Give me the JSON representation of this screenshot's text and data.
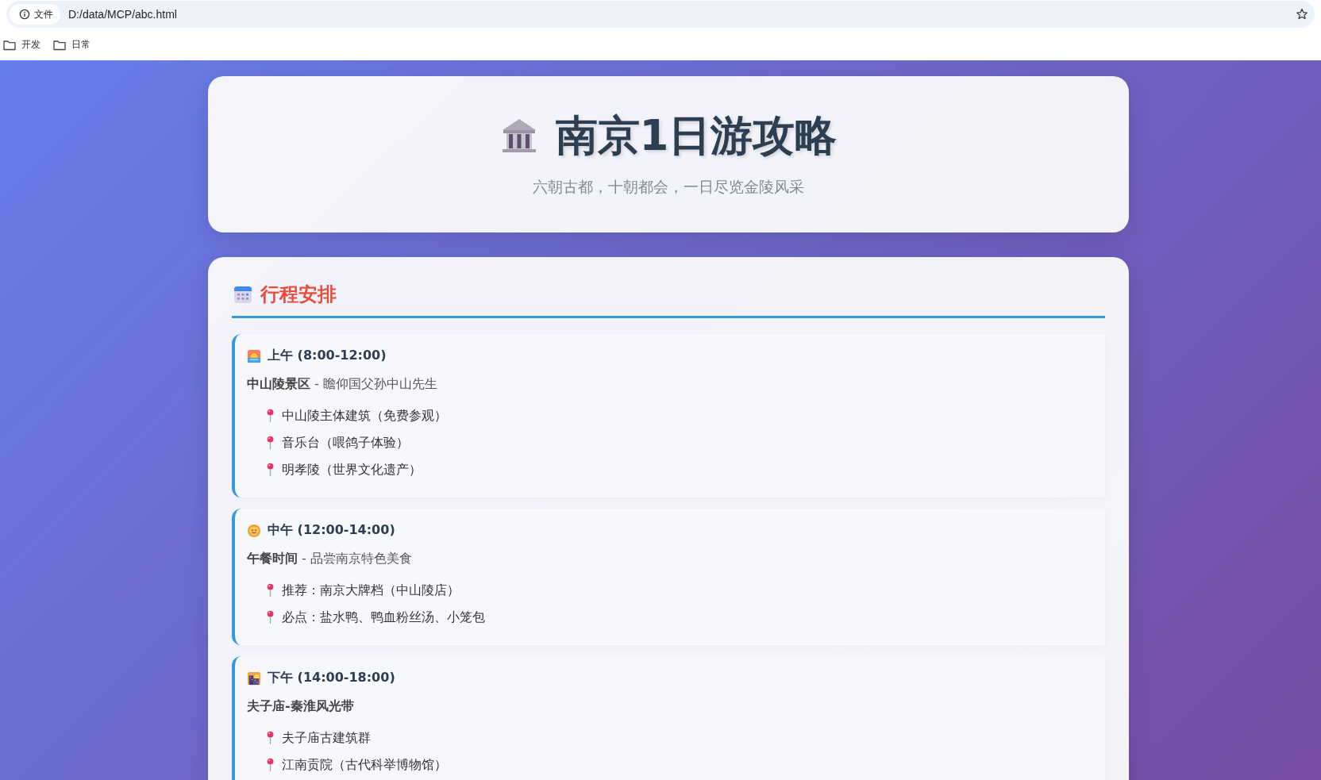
{
  "browser": {
    "security_label": "文件",
    "url": "D:/data/MCP/abc.html",
    "bookmarks": [
      "开发",
      "日常"
    ]
  },
  "header": {
    "title": "南京1日游攻略",
    "subtitle": "六朝古都，十朝都会，一日尽览金陵风采"
  },
  "schedule": {
    "title": "行程安排",
    "blocks": [
      {
        "kind": "sunrise",
        "time": "上午 (8:00-12:00)",
        "place": "中山陵景区",
        "note": "- 瞻仰国父孙中山先生",
        "items": [
          "中山陵主体建筑（免费参观）",
          "音乐台（喂鸽子体验）",
          "明孝陵（世界文化遗产）"
        ]
      },
      {
        "kind": "sun",
        "time": "中午 (12:00-14:00)",
        "place": "午餐时间",
        "note": "- 品尝南京特色美食",
        "items": [
          "推荐：南京大牌档（中山陵店）",
          "必点：盐水鸭、鸭血粉丝汤、小笼包"
        ]
      },
      {
        "kind": "city",
        "time": "下午 (14:00-18:00)",
        "place": "夫子庙-秦淮风光带",
        "items": [
          "夫子庙古建筑群",
          "江南贡院（古代科举博物馆）"
        ]
      }
    ]
  }
}
